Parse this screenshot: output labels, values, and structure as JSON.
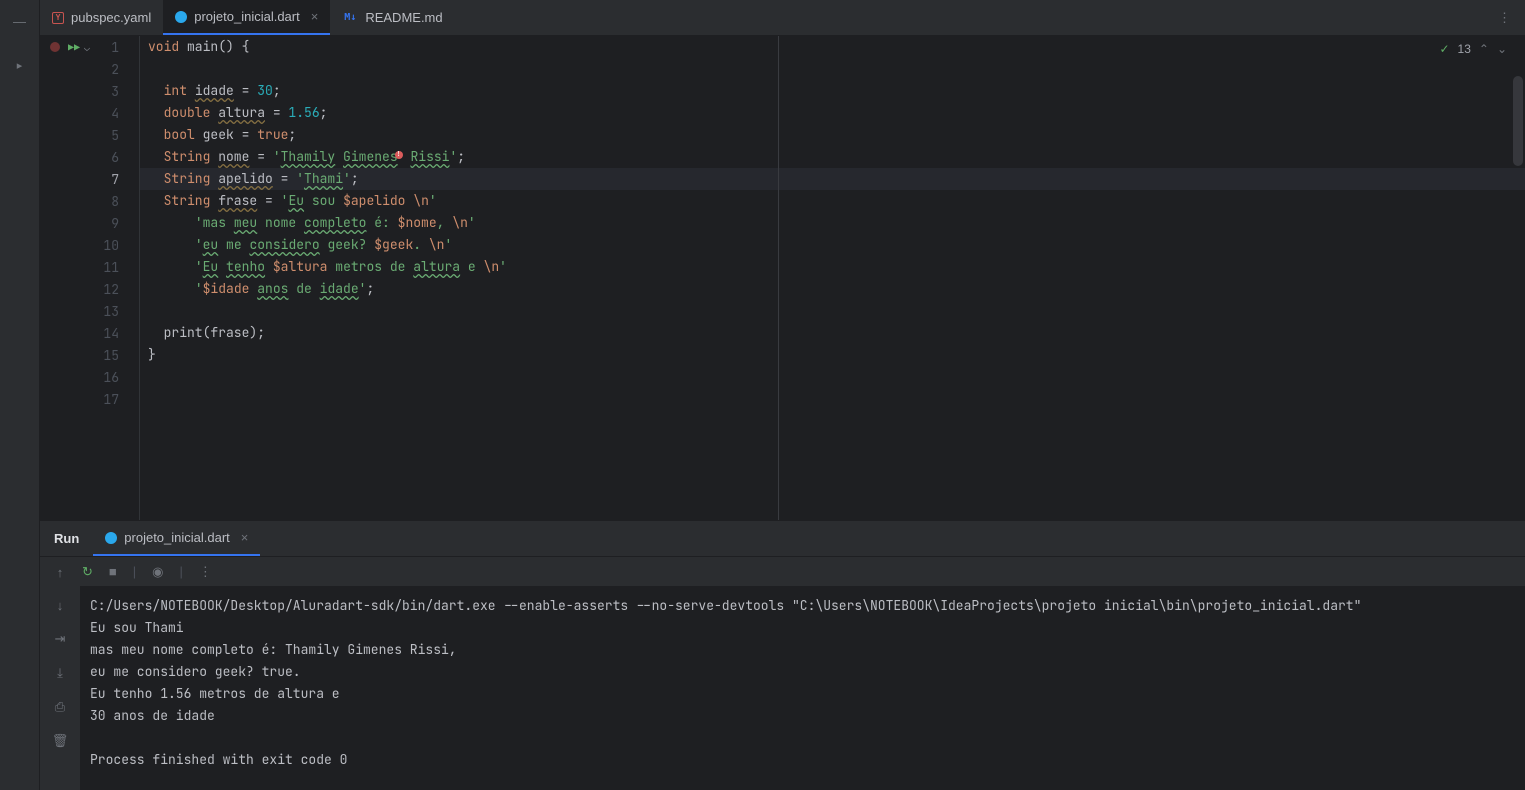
{
  "tabs": [
    {
      "label": "pubspec.yaml",
      "icon": "yaml",
      "active": false,
      "closable": false
    },
    {
      "label": "projeto_inicial.dart",
      "icon": "dart",
      "active": true,
      "closable": true
    },
    {
      "label": "README.md",
      "icon": "md",
      "active": false,
      "closable": false
    }
  ],
  "editor_status": {
    "problems_count": "13"
  },
  "code": {
    "lines": [
      "1",
      "2",
      "3",
      "4",
      "5",
      "6",
      "7",
      "8",
      "9",
      "10",
      "11",
      "12",
      "13",
      "14",
      "15",
      "16",
      "17"
    ],
    "highlighted_line": "7",
    "l1": {
      "a": "void",
      "b": " main() {"
    },
    "l3": {
      "a": "  int ",
      "b": "idade",
      "c": " = ",
      "d": "30",
      "e": ";"
    },
    "l4": {
      "a": "  double ",
      "b": "altura",
      "c": " = ",
      "d": "1.56",
      "e": ";"
    },
    "l5": {
      "a": "  bool ",
      "b": "geek = ",
      "c": "true",
      "d": ";"
    },
    "l6": {
      "a": "  String ",
      "b": "nome",
      "c": " = ",
      "d": "'",
      "e": "Thamily",
      "f": " ",
      "g": "Gimenes",
      "h": " ",
      "i": "Rissi",
      "j": "'",
      "k": ";"
    },
    "l7": {
      "a": "  String ",
      "b": "apelido",
      "c": " = ",
      "d": "'",
      "e": "Thami",
      "f": "'",
      "g": ";"
    },
    "l8": {
      "a": "  String ",
      "b": "frase",
      "c": " = ",
      "d": "'",
      "e": "Eu",
      "f": " sou ",
      "g": "$apelido",
      "h": " ",
      "i": "\\n",
      "j": "'"
    },
    "l9": {
      "a": "      ",
      "b": "'mas ",
      "c": "meu",
      "d": " nome ",
      "e": "completo",
      "f": " é: ",
      "g": "$nome",
      "h": ", ",
      "i": "\\n",
      "j": "'"
    },
    "l10": {
      "a": "      ",
      "b": "'",
      "c": "eu",
      "d": " me ",
      "e": "considero",
      "f": " geek? ",
      "g": "$geek",
      "h": ". ",
      "i": "\\n",
      "j": "'"
    },
    "l11": {
      "a": "      ",
      "b": "'",
      "c": "Eu",
      "d": " ",
      "e": "tenho",
      "f": " ",
      "g": "$altura",
      "h": " metros de ",
      "i": "altura",
      "j": " e ",
      "k": "\\n",
      "l": "'"
    },
    "l12": {
      "a": "      ",
      "b": "'",
      "c": "$idade",
      "d": " ",
      "e": "anos",
      "f": " de ",
      "g": "idade",
      "h": "'",
      "i": ";"
    },
    "l14": {
      "a": "  print(frase);"
    },
    "l15": {
      "a": "}"
    }
  },
  "run": {
    "title": "Run",
    "tab_label": "projeto_inicial.dart",
    "console": "C:/Users/NOTEBOOK/Desktop/Aluradart-sdk/bin/dart.exe --enable-asserts --no-serve-devtools \"C:\\Users\\NOTEBOOK\\IdeaProjects\\projeto inicial\\bin\\projeto_inicial.dart\"\nEu sou Thami \nmas meu nome completo é: Thamily Gimenes Rissi, \neu me considero geek? true. \nEu tenho 1.56 metros de altura e \n30 anos de idade\n\nProcess finished with exit code 0"
  }
}
